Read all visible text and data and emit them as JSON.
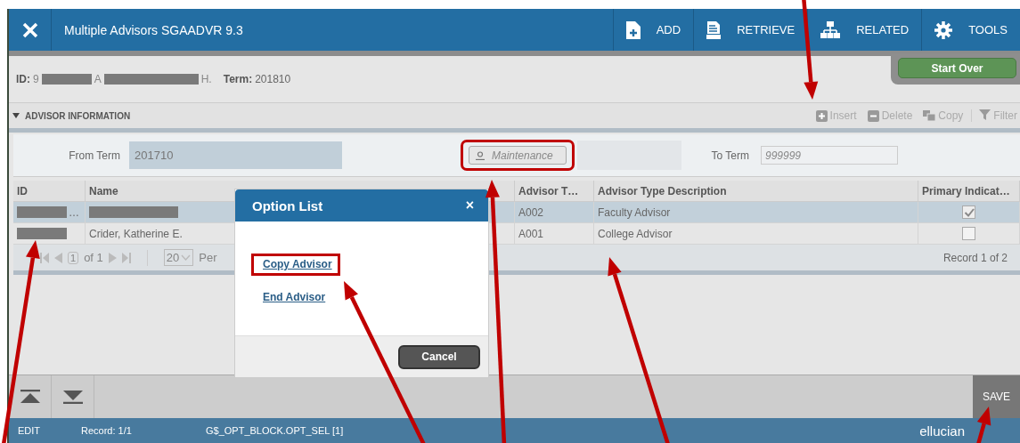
{
  "window": {
    "title": "Multiple Advisors SGAADVR 9.3"
  },
  "toolbar": [
    {
      "label": "ADD",
      "kind": "add"
    },
    {
      "label": "RETRIEVE",
      "kind": "retrieve"
    },
    {
      "label": "RELATED",
      "kind": "related"
    },
    {
      "label": "TOOLS",
      "kind": "tools"
    }
  ],
  "key_info": {
    "id_label": "ID:",
    "id_start": "9",
    "name_start": "A",
    "name_end": "H.",
    "term_label": "Term:",
    "term": "201810"
  },
  "start_over": "Start Over",
  "section": {
    "title": "ADVISOR INFORMATION",
    "expanded": true,
    "actions": [
      {
        "label": "Insert",
        "kind": "insert"
      },
      {
        "label": "Delete",
        "kind": "delete"
      },
      {
        "label": "Copy",
        "kind": "copy"
      },
      {
        "label": "Filter",
        "kind": "filter"
      }
    ]
  },
  "filters": {
    "from_label": "From Term",
    "from_value": "201710",
    "maintenance": {
      "placeholder": "Maintenance",
      "highlighted": true
    },
    "to_label": "To Term",
    "to_placeholder": "999999"
  },
  "table": {
    "columns": [
      "ID",
      "Name",
      "Advisor T…",
      "Advisor Type Description",
      "Primary Indicat…"
    ],
    "rows": [
      {
        "id": "…",
        "name": "",
        "type": "A002",
        "description": "Faculty Advisor",
        "primary": true,
        "selected": true
      },
      {
        "id": "",
        "name": "Crider, Katherine E.",
        "type": "A001",
        "description": "College Advisor",
        "primary": false,
        "selected": false
      }
    ]
  },
  "pager": {
    "page": "1",
    "of": "of 1",
    "per_page": "20",
    "per_label": "Per",
    "record": "Record 1 of 2"
  },
  "dialog": {
    "title": "Option List",
    "close": "×",
    "options": [
      {
        "label": "Copy Advisor",
        "highlighted": true
      },
      {
        "label": "End Advisor",
        "highlighted": false
      }
    ],
    "cancel": "Cancel"
  },
  "save": "SAVE",
  "status_bar": {
    "mode": "EDIT",
    "record": "Record: 1/1",
    "field": "G$_OPT_BLOCK.OPT_SEL [1]",
    "brand": "ellucian"
  }
}
